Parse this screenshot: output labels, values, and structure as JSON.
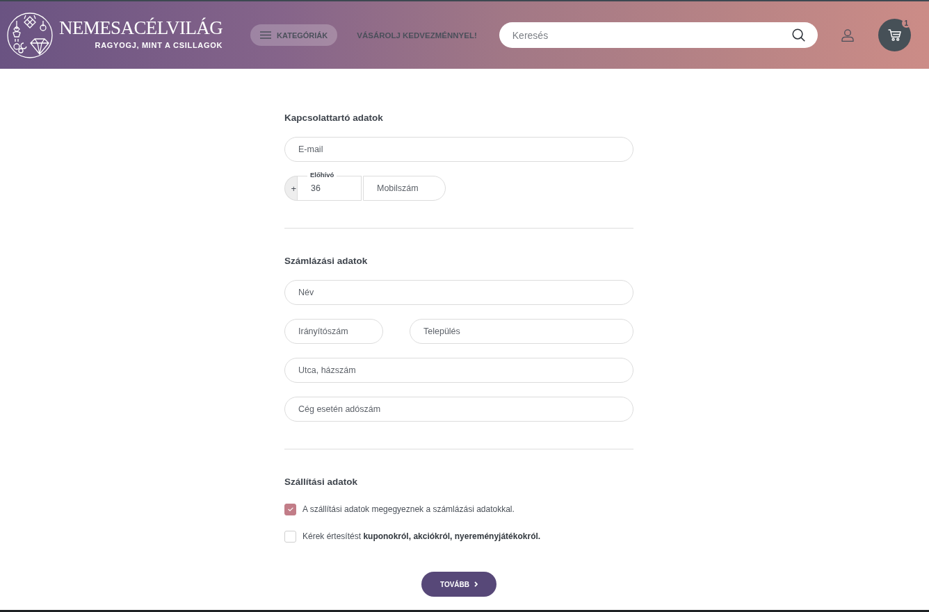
{
  "header": {
    "logo": {
      "name": "NEMESACÉLVILÁG",
      "tagline": "RAGYOGJ, MINT A CSILLAGOK"
    },
    "categories_button": {
      "label": "KATEGÓRIÁK"
    },
    "promo_link": "VÁSÁROLJ KEDVEZMÉNNYEL!",
    "search": {
      "placeholder": "Keresés"
    },
    "cart": {
      "count": "1"
    }
  },
  "sections": [
    {
      "title": "Kapcsolattartó adatok",
      "rows": [
        {
          "kind": "full",
          "fields": [
            {
              "placeholder": "E-mail"
            }
          ]
        },
        {
          "kind": "phone",
          "prefix": "+",
          "code_label": "Előhívó",
          "code_value": "36",
          "fields": [
            {
              "placeholder": "Mobilszám"
            }
          ]
        }
      ]
    },
    {
      "title": "Számlázási adatok",
      "rows": [
        {
          "kind": "full",
          "fields": [
            {
              "placeholder": "Név"
            }
          ]
        },
        {
          "kind": "split",
          "fields": [
            {
              "placeholder": "Irányítószám"
            },
            {
              "placeholder": "Település"
            }
          ]
        },
        {
          "kind": "full",
          "fields": [
            {
              "placeholder": "Utca, házszám"
            }
          ]
        },
        {
          "kind": "full",
          "fields": [
            {
              "placeholder": "Cég esetén adószám"
            }
          ]
        }
      ]
    },
    {
      "title": "Szállítási adatok",
      "options": [
        {
          "text": "A szállítási adatok megegyeznek a számlázási adatokkal.",
          "checked": true
        },
        {
          "text": "Kérek értesítést **kuponokról, akciókról, nyereményjátékokról.**",
          "checked": false
        }
      ]
    }
  ],
  "submit_button": {
    "label": "TOVÁBB"
  }
}
